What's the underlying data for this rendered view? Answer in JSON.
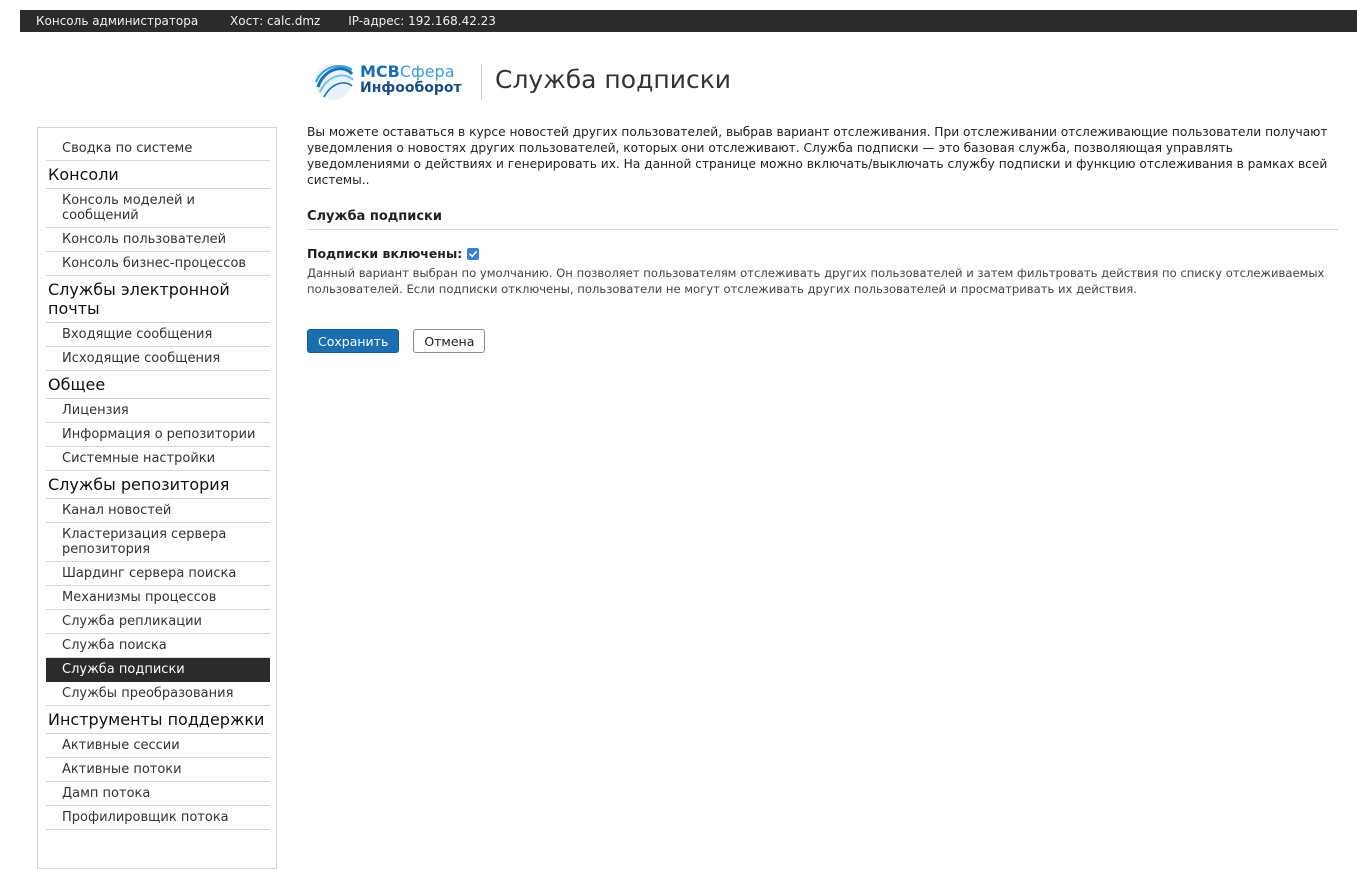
{
  "topbar": {
    "console_label": "Консоль администратора",
    "host": "Хост: calc.dmz",
    "ip": "IP-адрес: 192.168.42.23"
  },
  "header": {
    "logo_brand_1": "МСВ",
    "logo_brand_2": "Сфера",
    "logo_sub": "Инфооборот",
    "title": "Служба подписки"
  },
  "sidebar": {
    "items": [
      {
        "type": "item",
        "label": "Сводка по системе"
      },
      {
        "type": "group",
        "label": "Консоли"
      },
      {
        "type": "item",
        "label": "Консоль моделей и сообщений"
      },
      {
        "type": "item",
        "label": "Консоль пользователей"
      },
      {
        "type": "item",
        "label": "Консоль бизнес-процессов"
      },
      {
        "type": "group",
        "label": "Службы электронной почты"
      },
      {
        "type": "item",
        "label": "Входящие сообщения"
      },
      {
        "type": "item",
        "label": "Исходящие сообщения"
      },
      {
        "type": "group",
        "label": "Общее"
      },
      {
        "type": "item",
        "label": "Лицензия"
      },
      {
        "type": "item",
        "label": "Информация о репозитории"
      },
      {
        "type": "item",
        "label": "Системные настройки"
      },
      {
        "type": "group",
        "label": "Службы репозитория"
      },
      {
        "type": "item",
        "label": "Канал новостей"
      },
      {
        "type": "item",
        "label": "Кластеризация сервера репозитория"
      },
      {
        "type": "item",
        "label": "Шардинг сервера поиска"
      },
      {
        "type": "item",
        "label": "Механизмы процессов"
      },
      {
        "type": "item",
        "label": "Служба репликации"
      },
      {
        "type": "item",
        "label": "Служба поиска"
      },
      {
        "type": "item",
        "label": "Служба подписки",
        "active": true
      },
      {
        "type": "item",
        "label": "Службы преобразования"
      },
      {
        "type": "group",
        "label": "Инструменты поддержки"
      },
      {
        "type": "item",
        "label": "Активные сессии"
      },
      {
        "type": "item",
        "label": "Активные потоки"
      },
      {
        "type": "item",
        "label": "Дамп потока"
      },
      {
        "type": "item",
        "label": "Профилировщик потока"
      }
    ]
  },
  "main": {
    "description": "Вы можете оставаться в курсе новостей других пользователей, выбрав вариант отслеживания. При отслеживании отслеживающие пользователи получают уведомления о новостях других пользователей, которых они отслеживают. Служба подписки — это базовая служба, позволяющая управлять уведомлениями о действиях и генерировать их. На данной странице можно включать/выключать службу подписки и функцию отслеживания в рамках всей системы..",
    "section_title": "Служба подписки",
    "subscriptions_label": "Подписки включены:",
    "subscriptions_enabled": true,
    "help_text": "Данный вариант выбран по умолчанию. Он позволяет пользователям отслеживать других пользователей и затем фильтровать действия по списку отслеживаемых пользователей. Если подписки отключены, пользователи не могут отслеживать других пользователей и просматривать их действия.",
    "save_label": "Сохранить",
    "cancel_label": "Отмена"
  },
  "colors": {
    "accent": "#1a6fb3",
    "topbar_bg": "#2b2b2b",
    "active_nav_bg": "#2b2b2b",
    "checkbox": "#3d7fd0"
  }
}
